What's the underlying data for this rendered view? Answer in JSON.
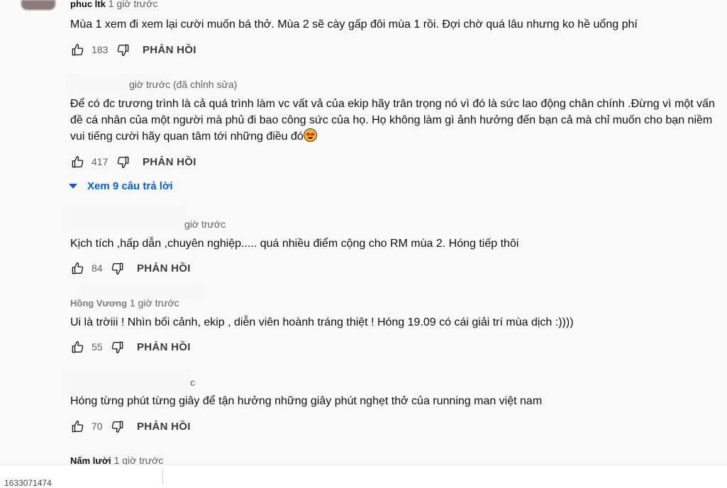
{
  "comments": [
    {
      "author": "phuc ltk",
      "time": "1 giờ trước",
      "text": "Mùa 1 xem đi xem lại cười muốn bá thở. Mùa 2 sẽ cày gấp đôi mùa 1 rồi. Đợi chờ quá lâu nhưng ko hề uổng phí",
      "likes": "183",
      "reply_label": "PHẢN HỒI"
    },
    {
      "time": "giờ trước (đã chỉnh sửa)",
      "text": "Để có đc trương trình là cả quá trình làm vc vất vả của ekip hãy trân trọng nó vì đó là sức lao động chân chính .Đừng vì một vấn đề cá nhân của một người mà phủ đi bao công sức của họ. Họ không làm gì ảnh hưởng đến bạn cả mà chỉ muốn cho bạn niềm vui tiếng cười hãy quan tâm tới những điều đó",
      "likes": "417",
      "reply_label": "PHẢN HỒI",
      "replies_toggle": "Xem 9 câu trả lời"
    },
    {
      "time": "giờ trước",
      "text": "Kịch tích ,hấp dẫn ,chuyên nghiệp..... quá nhiều điểm cộng cho RM mùa 2. Hóng tiếp thôi",
      "likes": "84",
      "reply_label": "PHẢN HỒI"
    },
    {
      "author": "Hồng Vương",
      "time": "1 giờ trước",
      "text": "Ui là trờiii ! Nhìn bối cảnh, ekip , diễn viên hoành tráng thiệt ! Hóng 19.09 có cái giải trí mùa dịch :))))",
      "likes": "55",
      "reply_label": "PHẢN HỒI"
    },
    {
      "time": "c",
      "text": "Hóng từng phút từng giây để tận hưởng những giây phút nghẹt thở của running man việt nam",
      "likes": "70",
      "reply_label": "PHẢN HỒI"
    },
    {
      "author": "Nấm lười",
      "time": "1 giờ trước"
    }
  ],
  "bottom_bar": {
    "status": "1633071474"
  },
  "icons": {
    "like": "thumbs-up-icon",
    "dislike": "thumbs-down-icon",
    "caret": "caret-down-icon",
    "emoji": "heart-eyes-emoji-icon"
  },
  "colors": {
    "link_blue": "#065fd4",
    "background": "#f9f9f9",
    "text": "#0f0f0f",
    "muted": "#606060"
  }
}
